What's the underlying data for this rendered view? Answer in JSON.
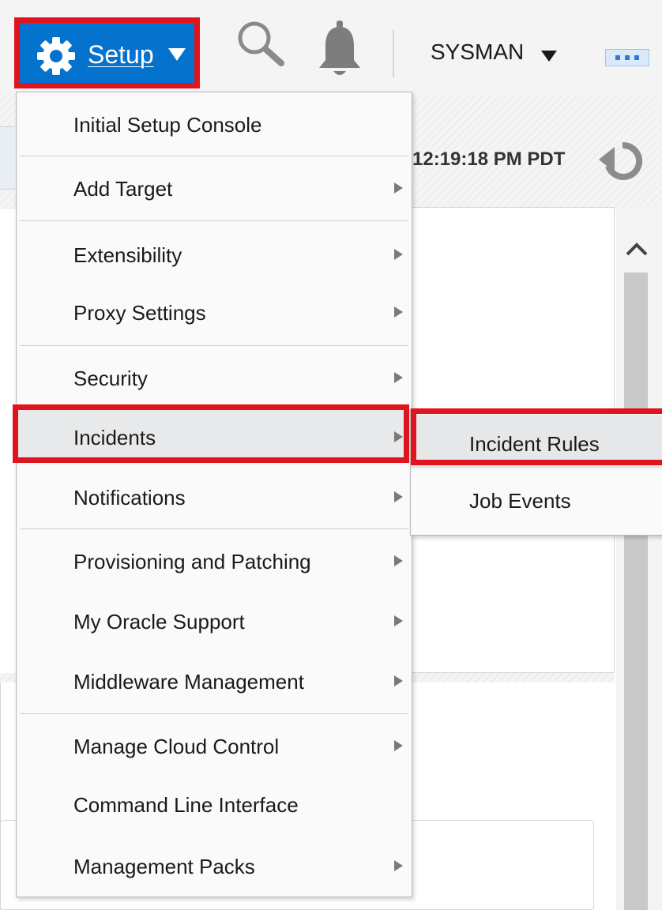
{
  "header": {
    "setup_label": "Setup",
    "user_label": "SYSMAN"
  },
  "page": {
    "timestamp": "12:19:18 PM PDT"
  },
  "setup_menu": {
    "items": [
      {
        "label": "Initial Setup Console",
        "has_submenu": false
      },
      {
        "label": "Add Target",
        "has_submenu": true
      },
      {
        "label": "Extensibility",
        "has_submenu": true
      },
      {
        "label": "Proxy Settings",
        "has_submenu": true
      },
      {
        "label": "Security",
        "has_submenu": true
      },
      {
        "label": "Incidents",
        "has_submenu": true,
        "active": true
      },
      {
        "label": "Notifications",
        "has_submenu": true
      },
      {
        "label": "Provisioning and Patching",
        "has_submenu": true
      },
      {
        "label": "My Oracle Support",
        "has_submenu": true
      },
      {
        "label": "Middleware Management",
        "has_submenu": true
      },
      {
        "label": "Manage Cloud Control",
        "has_submenu": true
      },
      {
        "label": "Command Line Interface",
        "has_submenu": false
      },
      {
        "label": "Management Packs",
        "has_submenu": true
      }
    ]
  },
  "incidents_submenu": {
    "items": [
      {
        "label": "Incident Rules",
        "active": true
      },
      {
        "label": "Job Events"
      }
    ]
  },
  "colors": {
    "accent_blue": "#0572ce",
    "highlight_red": "#e0141e",
    "menu_bg": "#fafafa",
    "active_item_bg": "#e8e9ea"
  },
  "icons": [
    "gear-icon",
    "search-icon",
    "bell-icon",
    "more-icon",
    "refresh-icon",
    "chevron-up-icon",
    "submenu-arrow-icon"
  ]
}
